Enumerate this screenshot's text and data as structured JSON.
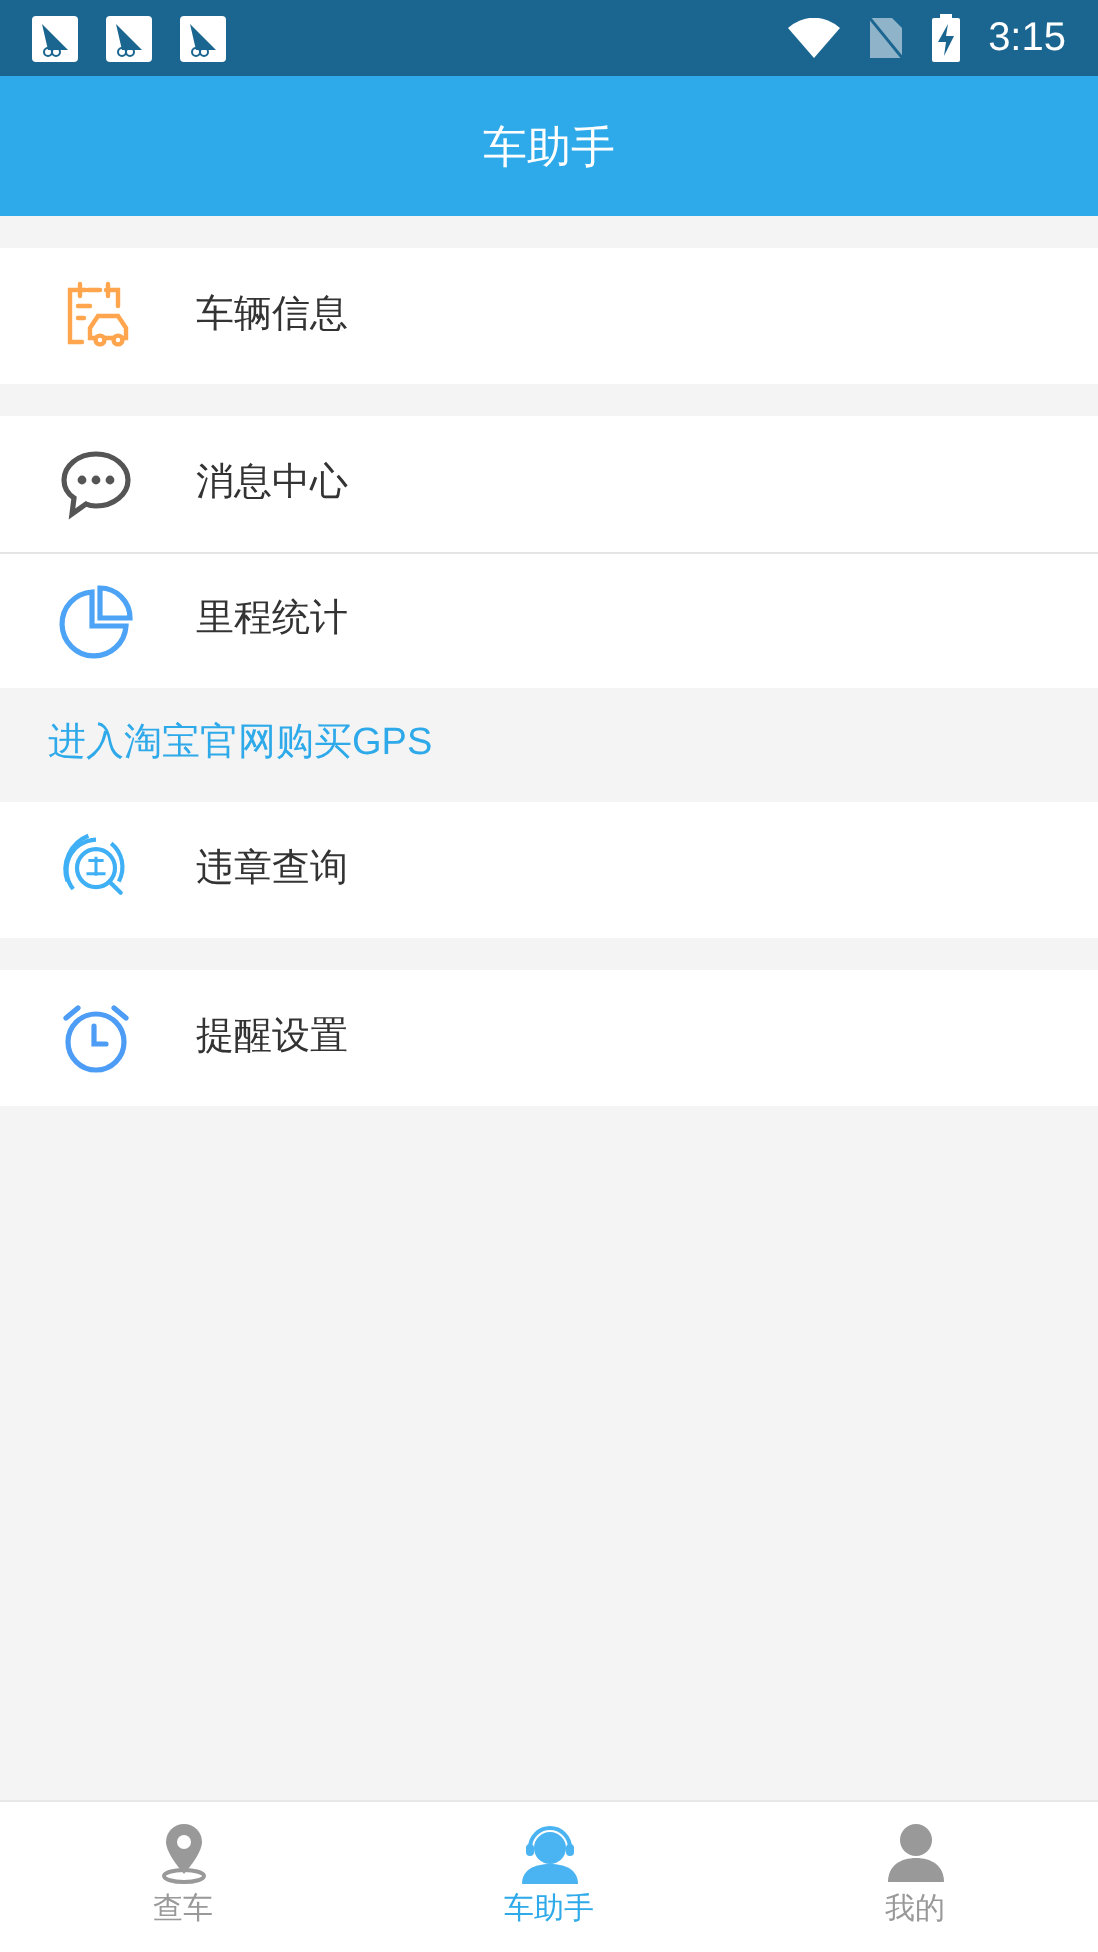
{
  "status_bar": {
    "time": "3:15"
  },
  "header": {
    "title": "车助手"
  },
  "sections": [
    {
      "kind": "group",
      "items": [
        {
          "label": "车辆信息"
        }
      ]
    },
    {
      "kind": "group",
      "items": [
        {
          "label": "消息中心"
        },
        {
          "label": "里程统计"
        }
      ]
    },
    {
      "kind": "link",
      "label": "进入淘宝官网购买GPS"
    },
    {
      "kind": "group",
      "items": [
        {
          "label": "违章查询"
        }
      ]
    },
    {
      "kind": "group",
      "items": [
        {
          "label": "提醒设置"
        }
      ]
    }
  ],
  "tabs": [
    {
      "label": "查车",
      "selected": false
    },
    {
      "label": "车助手",
      "selected": true
    },
    {
      "label": "我的",
      "selected": false
    }
  ]
}
